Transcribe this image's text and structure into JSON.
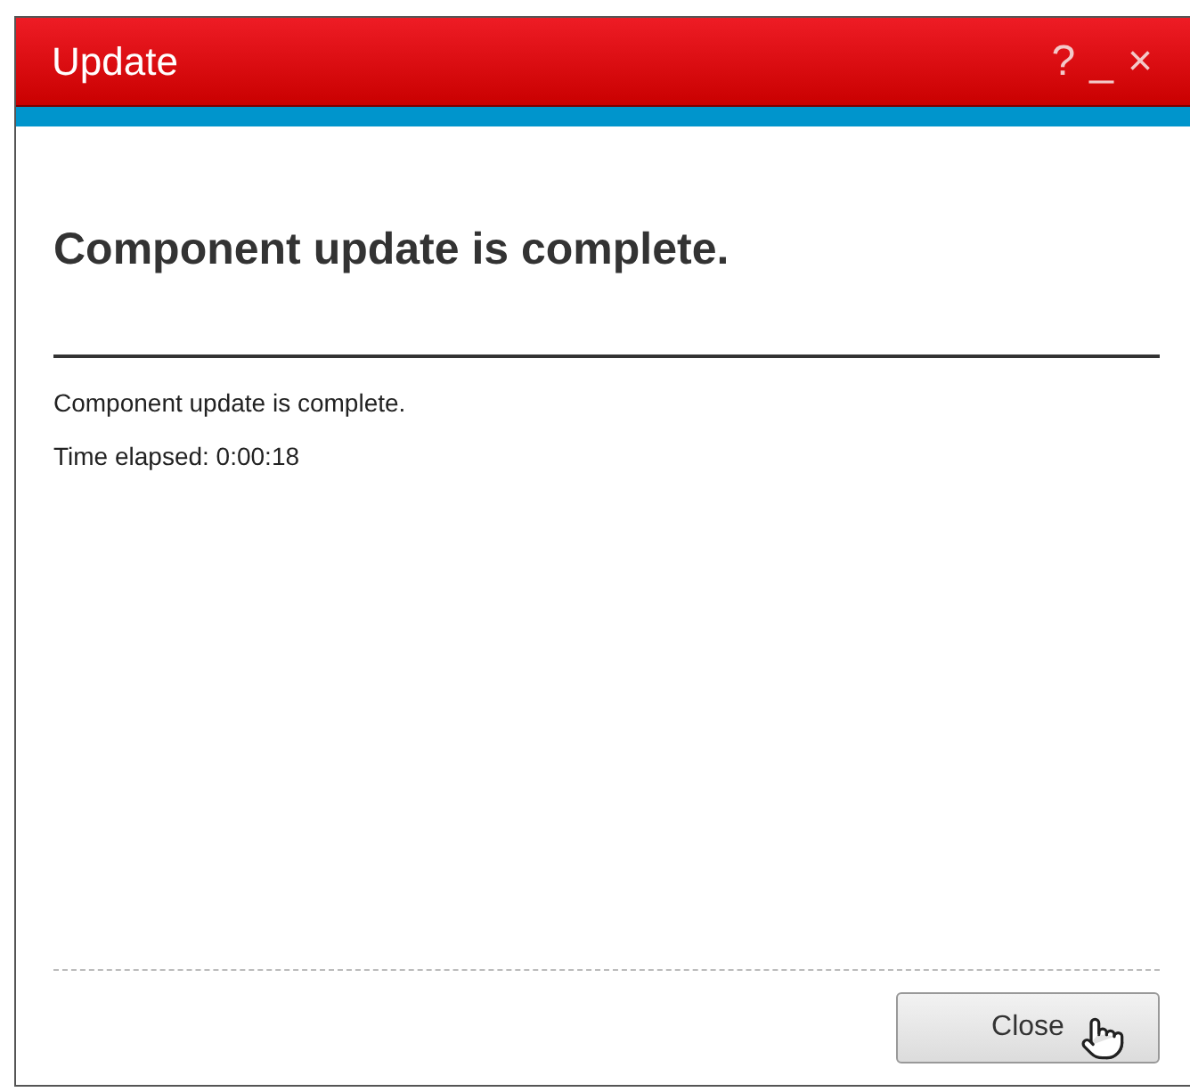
{
  "window": {
    "title": "Update",
    "controls": [
      "?",
      "_",
      "×"
    ]
  },
  "heading": "Component update is complete.",
  "messages": [
    "Component update is complete.",
    "Time elapsed: 0:00:18"
  ],
  "buttons": [
    "Close"
  ]
}
